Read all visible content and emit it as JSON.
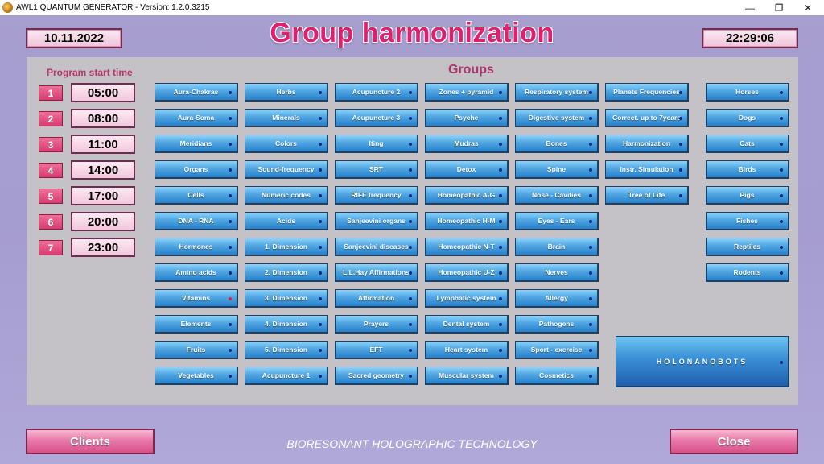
{
  "window": {
    "title": "AWL1 QUANTUM GENERATOR - Version: 1.2.0.3215",
    "minimize": "—",
    "restore": "❐",
    "close": "✕"
  },
  "header": {
    "date": "10.11.2022",
    "time": "22:29:06",
    "title": "Group harmonization"
  },
  "schedule": {
    "title": "Program start time",
    "rows": [
      {
        "num": "1",
        "time": "05:00"
      },
      {
        "num": "2",
        "time": "08:00"
      },
      {
        "num": "3",
        "time": "11:00"
      },
      {
        "num": "4",
        "time": "14:00"
      },
      {
        "num": "5",
        "time": "17:00"
      },
      {
        "num": "6",
        "time": "20:00"
      },
      {
        "num": "7",
        "time": "23:00"
      }
    ]
  },
  "groups": {
    "title": "Groups",
    "columns": [
      [
        "Aura-Chakras",
        "Aura-Soma",
        "Meridians",
        "Organs",
        "Cells",
        "DNA - RNA",
        "Hormones",
        "Amino acids",
        "Vitamins",
        "Elements",
        "Fruits",
        "Vegetables"
      ],
      [
        "Herbs",
        "Minerals",
        "Colors",
        "Sound-frequency",
        "Numeric codes",
        "Acids",
        "1. Dimension",
        "2. Dimension",
        "3. Dimension",
        "4. Dimension",
        "5. Dimension",
        "Acupuncture 1"
      ],
      [
        "Acupuncture 2",
        "Acupuncture 3",
        "Iting",
        "SRT",
        "RIFE frequency",
        "Sanjeevini organs",
        "Sanjeevini diseases",
        "L.L.Hay Affirmations",
        "Affirmation",
        "Prayers",
        "EFT",
        "Sacred geometry"
      ],
      [
        "Zones + pyramid",
        "Psyche",
        "Mudras",
        "Detox",
        "Homeopathic A-G",
        "Homeopathic H-M",
        "Homeopathic N-T",
        "Homeopathic U-Z",
        "Lymphatic system",
        "Dental system",
        "Heart system",
        "Muscular system"
      ],
      [
        "Respiratory system",
        "Digestive system",
        "Bones",
        "Spine",
        "Nose - Cavities",
        "Eyes - Ears",
        "Brain",
        "Nerves",
        "Allergy",
        "Pathogens",
        "Sport - exercise",
        "Cosmetics"
      ],
      [
        "Planets Frequencies",
        "Correct. up to 7years",
        "Harmonization",
        "Instr. Simulation",
        "Tree of Life"
      ],
      [
        "Horses",
        "Dogs",
        "Cats",
        "Birds",
        "Pigs",
        "Fishes",
        "Reptiles",
        "Rodents"
      ]
    ],
    "highlighted": "Vitamins",
    "colors": {
      "dot": "#0a2a8a",
      "dot_active": "#e0242f"
    },
    "holonanobots": "HOLONANOBOTS"
  },
  "footer": {
    "clients_label": "Clients",
    "close_label": "Close",
    "tagline": "BIORESONANT HOLOGRAPHIC TECHNOLOGY"
  },
  "colors": {
    "title_pink": "#e0206f",
    "button_blue": "#4ea7e4",
    "background": "#a79fcf"
  }
}
